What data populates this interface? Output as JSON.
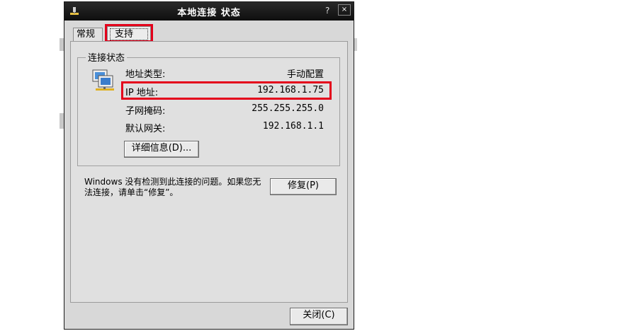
{
  "window": {
    "title": "本地连接 状态",
    "help_label": "?",
    "close_label": "×"
  },
  "tabs": [
    {
      "label": "常规",
      "active": false
    },
    {
      "label": "支持",
      "active": true
    }
  ],
  "group": {
    "legend": "连接状态",
    "rows": [
      {
        "label": "地址类型:",
        "value": "手动配置"
      },
      {
        "label": "IP 地址:",
        "value": "192.168.1.75"
      },
      {
        "label": "子网掩码:",
        "value": "255.255.255.0"
      },
      {
        "label": "默认网关:",
        "value": "192.168.1.1"
      }
    ],
    "details_button": "详细信息(D)..."
  },
  "message": "Windows 没有检测到此连接的问题。如果您无法连接，请单击“修复”。",
  "repair_button": "修复(P)",
  "close_button": "关闭(C)",
  "highlight_color": "#e4001b",
  "icons": [
    "network-connection-icon",
    "window-icon"
  ]
}
